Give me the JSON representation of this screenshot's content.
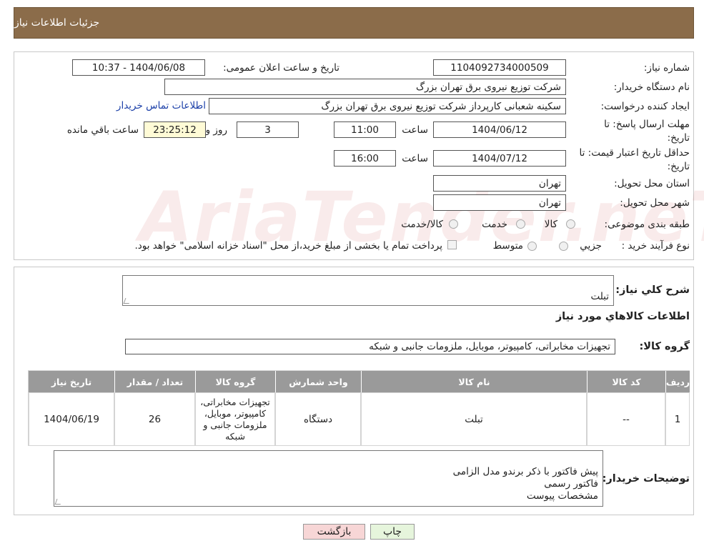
{
  "header": {
    "title": "جزئیات اطلاعات نیاز"
  },
  "fields": {
    "need_number_label": "شماره نیاز:",
    "need_number": "1104092734000509",
    "announce_label": "تاریخ و ساعت اعلان عمومی:",
    "announce_value": "1404/06/08 - 10:37",
    "buyer_org_label": "نام دستگاه خریدار:",
    "buyer_org": "شرکت توزیع نیروی برق تهران بزرگ",
    "requester_label": "ایجاد کننده درخواست:",
    "requester": "سکینه شعبانی کارپرداز شرکت توزیع نیروی برق تهران بزرگ",
    "contact_link": "اطلاعات تماس خریدار",
    "deadline_label_1": "مهلت ارسال پاسخ: تا",
    "deadline_label_2": "تاریخ:",
    "deadline_date": "1404/06/12",
    "time_label": "ساعت",
    "deadline_time": "11:00",
    "days_value": "3",
    "days_label": "روز و",
    "remaining_time": "23:25:12",
    "remaining_label": "ساعت باقي مانده",
    "validity_label_1": "حداقل تاریخ اعتبار قیمت: تا",
    "validity_label_2": "تاریخ:",
    "validity_date": "1404/07/12",
    "validity_time": "16:00",
    "province_label": "استان محل تحویل:",
    "province": "تهران",
    "city_label": "شهر محل تحویل:",
    "city": "تهران",
    "category_label": "طبقه بندی موضوعی:",
    "category_options": [
      "کالا",
      "خدمت",
      "کالا/خدمت"
    ],
    "process_label": "نوع فرآیند خرید :",
    "process_options": [
      "جزیي",
      "متوسط"
    ],
    "process_note": "پرداخت تمام یا بخشی از مبلغ خرید،از محل \"اسناد خزانه اسلامی\" خواهد بود."
  },
  "summary": {
    "desc_label": "شرح کلي نياز:",
    "desc_value": "تبلت",
    "goods_info_title": "اطلاعات کالاهاي مورد نياز",
    "group_label": "گروه کالا:",
    "group_value": "تجهیزات مخابراتی، کامپیوتر، موبایل، ملزومات جانبی و شبکه"
  },
  "table": {
    "headers": [
      "رديف",
      "کد کالا",
      "نام کالا",
      "واحد شمارش",
      "گروه کالا",
      "تعداد / مقدار",
      "تاريخ نياز"
    ],
    "rows": [
      [
        "1",
        "--",
        "تبلت",
        "دستگاه",
        "تجهیزات مخابراتی، کامپیوتر، موبایل، ملزومات جانبی و شبکه",
        "26",
        "1404/06/19"
      ]
    ]
  },
  "buyer_notes": {
    "label": "توضیحات خریدار:",
    "value": "پیش فاکتور با ذکر برندو مدل  الزامی\nفاکتور رسمی\nمشخصات پیوست"
  },
  "buttons": {
    "print": "چاپ",
    "back": "بازگشت"
  },
  "watermark": "AriaTender.neT",
  "colors": {
    "header": "#8b6c4a",
    "table_header": "#9a9a9a",
    "back_button": "#f7d6d6",
    "print_button": "#e6f5dc"
  }
}
